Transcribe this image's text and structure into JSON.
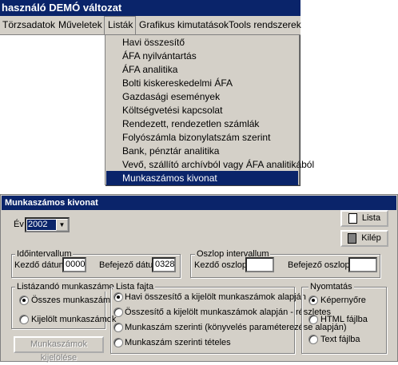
{
  "window": {
    "title": "használó  DEMÓ változat"
  },
  "menubar": [
    {
      "label": "Törzsadatok"
    },
    {
      "label": "Műveletek"
    },
    {
      "label": "Listák"
    },
    {
      "label": "Grafikus kimutatások"
    },
    {
      "label": "Tools rendszerek"
    }
  ],
  "dropdown": [
    {
      "label": "Havi összesítő"
    },
    {
      "label": "ÁFA nyilvántartás"
    },
    {
      "label": "ÁFA analitika"
    },
    {
      "label": "Bolti kiskereskedelmi ÁFA"
    },
    {
      "label": "Gazdasági események"
    },
    {
      "label": "Költségvetési kapcsolat"
    },
    {
      "label": "Rendezett, rendezetlen számlák"
    },
    {
      "label": "Folyószámla bizonylatszám szerint"
    },
    {
      "label": "Bank, pénztár analitika"
    },
    {
      "label": "Vevő, szállító archívból vagy ÁFA analitikából"
    },
    {
      "label": "Munkaszámos kivonat"
    }
  ],
  "dialog": {
    "title": "Munkaszámos kivonat",
    "year_label": "Év",
    "year_value": "2002",
    "btn_lista": "Lista",
    "btn_kilep": "Kilép",
    "idointervallum": {
      "title": "Időintervallum",
      "start_label": "Kezdő dátum:",
      "start_value": "0000",
      "end_label": "Befejező dátum:",
      "end_value": "0328"
    },
    "oszlop": {
      "title": "Oszlop intervallum",
      "start_label": "Kezdő oszlop:",
      "start_value": "",
      "end_label": "Befejező oszlop:",
      "end_value": ""
    },
    "listazando": {
      "title": "Listázandó munkaszámok",
      "options": [
        "Összes munkaszám",
        "Kijelölt munkaszámok"
      ],
      "selected": 0
    },
    "kijelolese_button": "Munkaszámok kijelölése",
    "lista_fajta": {
      "title": "Lista fajta",
      "options": [
        "Havi összesítő a kijelölt munkaszámok alapján",
        "Összesítő a kijelölt munkaszámok alapján - részletes",
        "Munkaszám szerinti (könyvelés paraméterezése alapján)",
        "Munkaszám szerinti tételes"
      ],
      "selected": 0
    },
    "nyomtatas": {
      "title": "Nyomtatás",
      "options": [
        "Képernyőre",
        "HTML fájlba",
        "Text fájlba"
      ],
      "selected": 0
    }
  }
}
